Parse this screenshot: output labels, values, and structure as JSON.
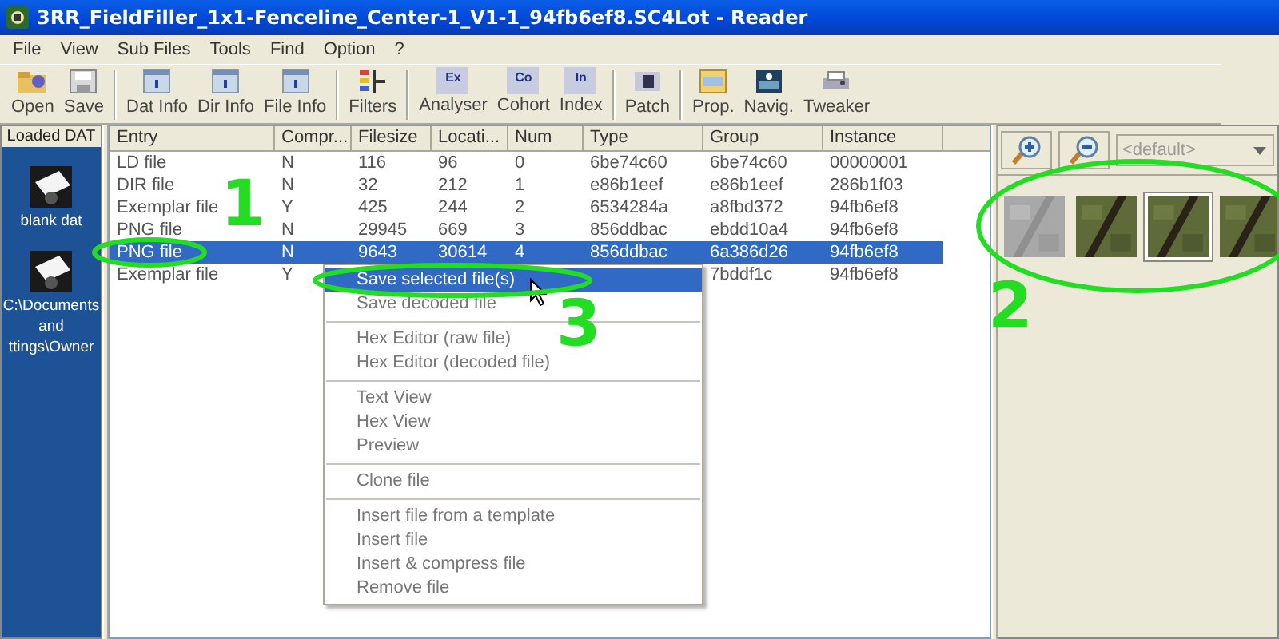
{
  "window": {
    "title": "3RR_FieldFiller_1x1-Fenceline_Center-1_V1-1_94fb6ef8.SC4Lot - Reader"
  },
  "menu": [
    "File",
    "View",
    "Sub Files",
    "Tools",
    "Find",
    "Option",
    "?"
  ],
  "toolbar": [
    [
      {
        "label": "Open"
      },
      {
        "label": "Save"
      }
    ],
    [
      {
        "label": "Dat Info"
      },
      {
        "label": "Dir Info"
      },
      {
        "label": "File Info"
      }
    ],
    [
      {
        "label": "Filters"
      }
    ],
    [
      {
        "label": "Analyser",
        "icon_text": "Ex"
      },
      {
        "label": "Cohort",
        "icon_text": "Co"
      },
      {
        "label": "Index",
        "icon_text": "In"
      }
    ],
    [
      {
        "label": "Patch"
      }
    ],
    [
      {
        "label": "Prop."
      },
      {
        "label": "Navig."
      },
      {
        "label": "Tweaker"
      }
    ]
  ],
  "loaded_dat": {
    "header": "Loaded DAT",
    "items": [
      {
        "lines": [
          "blank dat"
        ]
      },
      {
        "lines": [
          "C:\\Documents",
          "and",
          "ttings\\Owner"
        ]
      }
    ]
  },
  "table": {
    "columns": [
      "Entry",
      "Compr...",
      "Filesize",
      "Locati...",
      "Num",
      "Type",
      "Group",
      "Instance"
    ],
    "rows": [
      {
        "cells": [
          "LD file",
          "N",
          "116",
          "96",
          "0",
          "6be74c60",
          "6be74c60",
          "00000001"
        ],
        "selected": false
      },
      {
        "cells": [
          "DIR file",
          "N",
          "32",
          "212",
          "1",
          "e86b1eef",
          "e86b1eef",
          "286b1f03"
        ],
        "selected": false
      },
      {
        "cells": [
          "Exemplar file",
          "Y",
          "425",
          "244",
          "2",
          "6534284a",
          "a8fbd372",
          "94fb6ef8"
        ],
        "selected": false
      },
      {
        "cells": [
          "PNG file",
          "N",
          "29945",
          "669",
          "3",
          "856ddbac",
          "ebdd10a4",
          "94fb6ef8"
        ],
        "selected": false
      },
      {
        "cells": [
          "PNG file",
          "N",
          "9643",
          "30614",
          "4",
          "856ddbac",
          "6a386d26",
          "94fb6ef8"
        ],
        "selected": true
      },
      {
        "cells": [
          "Exemplar file",
          "Y",
          null,
          null,
          null,
          null,
          "7bddf1c",
          "94fb6ef8"
        ],
        "selected": false
      }
    ]
  },
  "context_menu": [
    [
      {
        "label": "Save selected file(s)",
        "selected": true
      },
      {
        "label": "Save decoded file",
        "selected": false
      }
    ],
    [
      {
        "label": "Hex Editor (raw file)",
        "selected": false
      },
      {
        "label": "Hex Editor (decoded file)",
        "selected": false
      }
    ],
    [
      {
        "label": "Text View",
        "selected": false
      },
      {
        "label": "Hex View",
        "selected": false
      },
      {
        "label": "Preview",
        "selected": false
      }
    ],
    [
      {
        "label": "Clone file",
        "selected": false
      }
    ],
    [
      {
        "label": "Insert file from a template",
        "selected": false
      },
      {
        "label": "Insert file",
        "selected": false
      },
      {
        "label": "Insert & compress file",
        "selected": false
      },
      {
        "label": "Remove file",
        "selected": false
      }
    ]
  ],
  "preview": {
    "dropdown": {
      "value": "<default>",
      "disabled": true
    },
    "thumbnails": [
      {
        "kind": "picture",
        "selected": false
      },
      {
        "kind": "picture",
        "selected": false
      },
      {
        "kind": "picture",
        "selected": true
      },
      {
        "kind": "picture",
        "selected": false
      }
    ]
  },
  "annotations": [
    {
      "label": "1"
    },
    {
      "label": "2"
    },
    {
      "label": "3"
    }
  ]
}
